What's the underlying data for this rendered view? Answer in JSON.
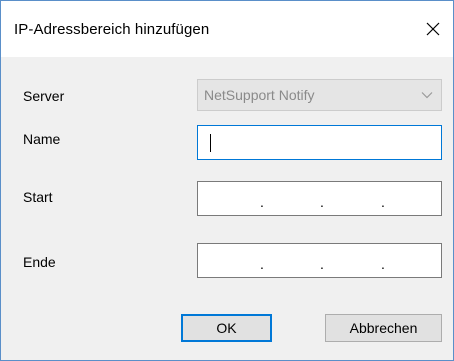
{
  "window": {
    "title": "IP-Adressbereich hinzufügen",
    "close_icon": "close-icon"
  },
  "form": {
    "server_label": "Server",
    "server_value": "NetSupport Notify",
    "name_label": "Name",
    "name_value": "",
    "start_label": "Start",
    "start_dots": [
      ".",
      ".",
      "."
    ],
    "end_label": "Ende",
    "end_dots": [
      ".",
      ".",
      "."
    ]
  },
  "buttons": {
    "ok_label": "OK",
    "cancel_label": "Abbrechen"
  },
  "colors": {
    "accent": "#0078d7",
    "dialog_background": "#f0f0f0",
    "window_border": "#5a8fc9"
  }
}
